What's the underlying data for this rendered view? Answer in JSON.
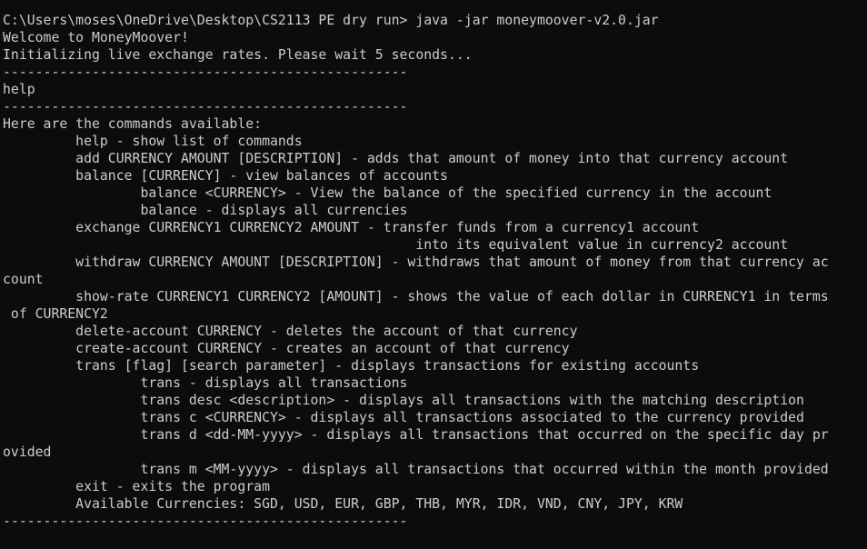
{
  "terminal": {
    "lines": [
      "C:\\Users\\moses\\OneDrive\\Desktop\\CS2113 PE dry run> java -jar moneymoover-v2.0.jar",
      "Welcome to MoneyMoover!",
      "Initializing live exchange rates. Please wait 5 seconds...",
      "--------------------------------------------------",
      "help",
      "--------------------------------------------------",
      "Here are the commands available:",
      "         help - show list of commands",
      "         add CURRENCY AMOUNT [DESCRIPTION] - adds that amount of money into that currency account",
      "         balance [CURRENCY] - view balances of accounts",
      "                 balance <CURRENCY> - View the balance of the specified currency in the account",
      "                 balance - displays all currencies",
      "         exchange CURRENCY1 CURRENCY2 AMOUNT - transfer funds from a currency1 account",
      "                                                   into its equivalent value in currency2 account",
      "         withdraw CURRENCY AMOUNT [DESCRIPTION] - withdraws that amount of money from that currency ac",
      "count",
      "         show-rate CURRENCY1 CURRENCY2 [AMOUNT] - shows the value of each dollar in CURRENCY1 in terms",
      " of CURRENCY2",
      "         delete-account CURRENCY - deletes the account of that currency",
      "         create-account CURRENCY - creates an account of that currency",
      "         trans [flag] [search parameter] - displays transactions for existing accounts",
      "                 trans - displays all transactions",
      "                 trans desc <description> - displays all transactions with the matching description",
      "                 trans c <CURRENCY> - displays all transactions associated to the currency provided",
      "                 trans d <dd-MM-yyyy> - displays all transactions that occurred on the specific day pr",
      "ovided",
      "                 trans m <MM-yyyy> - displays all transactions that occurred within the month provided",
      "         exit - exits the program",
      "         Available Currencies: SGD, USD, EUR, GBP, THB, MYR, IDR, VND, CNY, JPY, KRW",
      "--------------------------------------------------"
    ]
  },
  "colors": {
    "background": "#0c0c0c",
    "foreground": "#cccccc"
  }
}
